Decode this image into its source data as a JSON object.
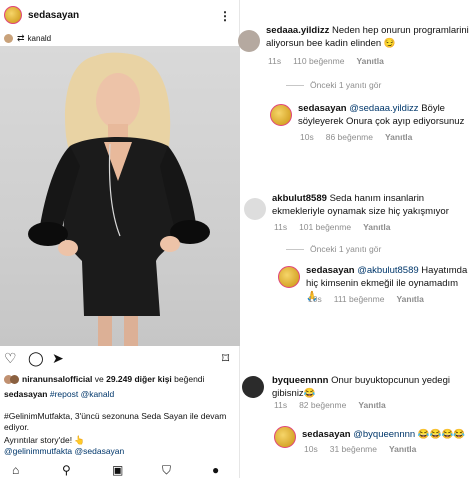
{
  "post": {
    "username": "sedasayan",
    "more_icon": "more-horizontal-icon",
    "repost_from": "kanald",
    "actions": {
      "like_icon": "heart-icon",
      "comment_icon": "comment-icon",
      "share_icon": "send-icon",
      "save_icon": "bookmark-icon"
    },
    "likes": {
      "user": "niranunsalofficial",
      "conj": "ve",
      "count_text": "29.249 diğer kişi",
      "suffix": "beğendi"
    },
    "caption_line1_user": "sedasayan",
    "caption_line1_text": "#repost @kanald",
    "caption_line2": "#GelinimMutfakta, 3'üncü sezonuna Seda Sayan ile devam",
    "caption_line3": "ediyor.",
    "caption_line4": "Ayrıntılar story'de! 👆",
    "caption_line5": "@gelinimmutfakta @sedasayan"
  },
  "bottom_nav": [
    "home-icon",
    "search-icon",
    "reels-icon",
    "shop-icon",
    "profile-icon"
  ],
  "comments": [
    {
      "user": "sedaaa.yildizz",
      "text": "Neden hep onurun programlarini aliyorsun bee kadin elinden 😏",
      "time": "11s",
      "likes": "110 beğenme",
      "reply": "Yanıtla",
      "thread": "Önceki 1 yanıtı gör"
    },
    {
      "user": "sedasayan",
      "mention": "@sedaaa.yildizz",
      "text": "Böyle söyleyerek Onura çok ayıp ediyorsunuz",
      "time": "10s",
      "likes": "86 beğenme",
      "reply": "Yanıtla"
    },
    {
      "user": "akbulut8589",
      "text": "Seda hanım insanlarin ekmekleriyle oynamak size hiç yakışmıyor",
      "time": "11s",
      "likes": "101 beğenme",
      "reply": "Yanıtla",
      "thread": "Önceki 1 yanıtı gör"
    },
    {
      "user": "sedasayan",
      "mention": "@akbulut8589",
      "text": "Hayatımda hiç kimsenin ekmeğil ile oynamadım 🙏",
      "time": "10s",
      "likes": "111 beğenme",
      "reply": "Yanıtla"
    },
    {
      "user": "byqueennnn",
      "text": "Onur buyuktopcunun yedegi gibisniz😂",
      "time": "11s",
      "likes": "82 beğenme",
      "reply": "Yanıtla"
    },
    {
      "user": "sedasayan",
      "mention": "@byqueennnn",
      "text": "😂😂😂😂",
      "time": "10s",
      "likes": "31 beğenme",
      "reply": "Yanıtla"
    }
  ]
}
